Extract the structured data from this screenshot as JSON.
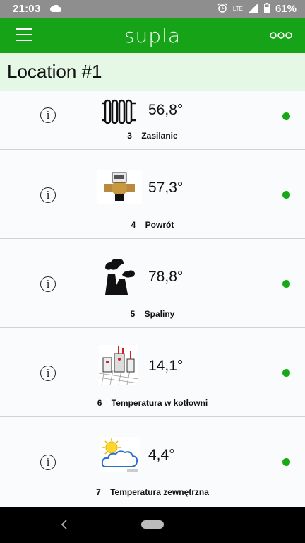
{
  "status_bar": {
    "time": "21:03",
    "network": "LTE",
    "battery": "61%"
  },
  "app_bar": {
    "title": "supla"
  },
  "location": {
    "name": "Location #1"
  },
  "channels": [
    {
      "number": "3",
      "name": "Zasilanie",
      "value": "56,8°",
      "icon": "radiator-icon",
      "online": true
    },
    {
      "number": "4",
      "name": "Powrót",
      "value": "57,3°",
      "icon": "valve-icon",
      "online": true
    },
    {
      "number": "5",
      "name": "Spaliny",
      "value": "78,8°",
      "icon": "chimney-smoke-icon",
      "online": true
    },
    {
      "number": "6",
      "name": "Temperatura w kotłowni",
      "value": "14,1°",
      "icon": "boiler-room-icon",
      "online": true
    },
    {
      "number": "7",
      "name": "Temperatura zewnętrzna",
      "value": "4,4°",
      "icon": "sun-cloud-icon",
      "online": true
    }
  ],
  "colors": {
    "accent": "#17a317",
    "location_bg": "#e5f7e5",
    "online_dot": "#16a916"
  }
}
